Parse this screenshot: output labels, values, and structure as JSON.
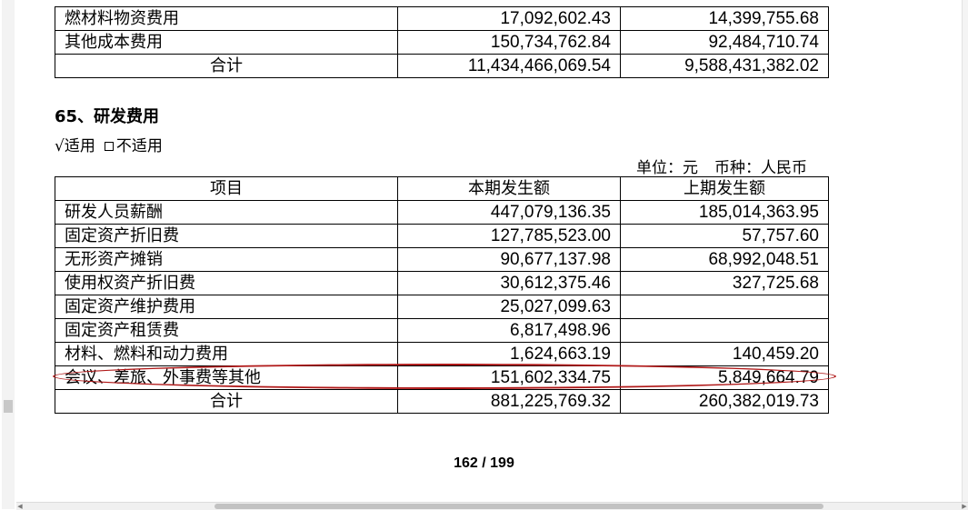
{
  "top_table": {
    "rows": [
      {
        "label": "燃材料物资费用",
        "current": "17,092,602.43",
        "previous": "14,399,755.68"
      },
      {
        "label": "其他成本费用",
        "current": "150,734,762.84",
        "previous": "92,484,710.74"
      }
    ],
    "total": {
      "label": "合计",
      "current": "11,434,466,069.54",
      "previous": "9,588,431,382.02"
    }
  },
  "section": {
    "title": "65、研发费用",
    "applicable_label": "√适用",
    "not_applicable_label": "不适用",
    "unit": "单位：元",
    "currency": "币种：人民币"
  },
  "rd_table": {
    "headers": {
      "item": "项目",
      "current": "本期发生额",
      "previous": "上期发生额"
    },
    "rows": [
      {
        "label": "研发人员薪酬",
        "current": "447,079,136.35",
        "previous": "185,014,363.95"
      },
      {
        "label": "固定资产折旧费",
        "current": "127,785,523.00",
        "previous": "57,757.60"
      },
      {
        "label": "无形资产摊销",
        "current": "90,677,137.98",
        "previous": "68,992,048.51"
      },
      {
        "label": "使用权资产折旧费",
        "current": "30,612,375.46",
        "previous": "327,725.68"
      },
      {
        "label": "固定资产维护费用",
        "current": "25,027,099.63",
        "previous": ""
      },
      {
        "label": "固定资产租赁费",
        "current": "6,817,498.96",
        "previous": ""
      },
      {
        "label": "材料、燃料和动力费用",
        "current": "1,624,663.19",
        "previous": "140,459.20"
      },
      {
        "label": "会议、差旅、外事费等其他",
        "current": "151,602,334.75",
        "previous": "5,849,664.79"
      }
    ],
    "total": {
      "label": "合计",
      "current": "881,225,769.32",
      "previous": "260,382,019.73"
    }
  },
  "page_number": "162 / 199",
  "highlight_color": "#b01818"
}
